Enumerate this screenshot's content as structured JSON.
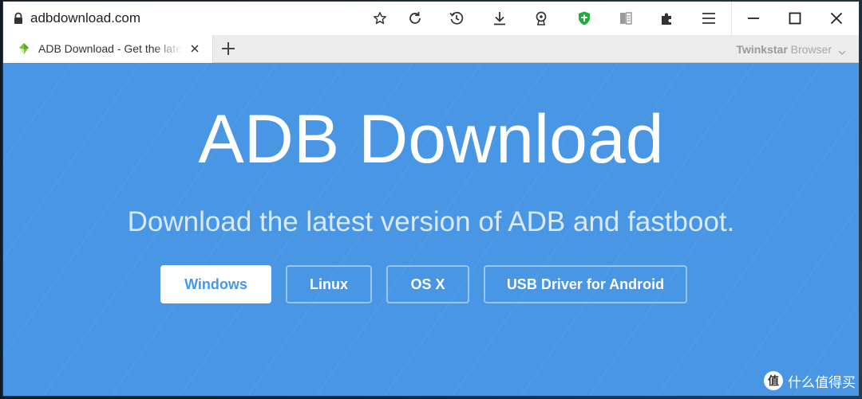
{
  "browser": {
    "url": "adbdownload.com",
    "tab": {
      "title": "ADB Download - Get the latest version"
    },
    "brand_bold": "Twinkstar",
    "brand_light": " Browser",
    "toolbar_icons": [
      "star-icon",
      "reload-icon",
      "history-icon",
      "download-icon",
      "webcam-icon",
      "shield-icon",
      "reader-icon",
      "extensions-icon",
      "menu-icon"
    ],
    "window_controls": [
      "minimize-icon",
      "maximize-icon",
      "close-icon"
    ]
  },
  "page": {
    "title": "ADB Download",
    "subtitle": "Download the latest version of ADB and fastboot.",
    "buttons": [
      {
        "label": "Windows"
      },
      {
        "label": "Linux"
      },
      {
        "label": "OS X"
      },
      {
        "label": "USB Driver for Android"
      }
    ],
    "background_color": "#4896e4"
  },
  "watermark": {
    "badge": "值",
    "text": "什么值得买"
  }
}
